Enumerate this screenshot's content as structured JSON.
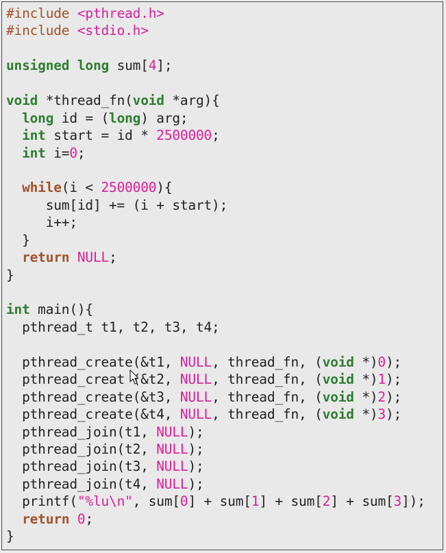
{
  "editor": {
    "lines": [
      [
        {
          "t": "pp",
          "v": "#include "
        },
        {
          "t": "hdr",
          "v": "<pthread.h>"
        }
      ],
      [
        {
          "t": "pp",
          "v": "#include "
        },
        {
          "t": "hdr",
          "v": "<stdio.h>"
        }
      ],
      [],
      [
        {
          "t": "kw",
          "v": "unsigned long"
        },
        {
          "t": "plain",
          "v": " sum["
        },
        {
          "t": "num",
          "v": "4"
        },
        {
          "t": "plain",
          "v": "];"
        }
      ],
      [],
      [
        {
          "t": "kw",
          "v": "void"
        },
        {
          "t": "plain",
          "v": " *thread_fn("
        },
        {
          "t": "kw",
          "v": "void"
        },
        {
          "t": "plain",
          "v": " *arg){"
        }
      ],
      [
        {
          "t": "plain",
          "v": "  "
        },
        {
          "t": "kw",
          "v": "long"
        },
        {
          "t": "plain",
          "v": " id = ("
        },
        {
          "t": "kw",
          "v": "long"
        },
        {
          "t": "plain",
          "v": ") arg;"
        }
      ],
      [
        {
          "t": "plain",
          "v": "  "
        },
        {
          "t": "kw",
          "v": "int"
        },
        {
          "t": "plain",
          "v": " start = id * "
        },
        {
          "t": "num",
          "v": "2500000"
        },
        {
          "t": "plain",
          "v": ";"
        }
      ],
      [
        {
          "t": "plain",
          "v": "  "
        },
        {
          "t": "kw",
          "v": "int"
        },
        {
          "t": "plain",
          "v": " i="
        },
        {
          "t": "num",
          "v": "0"
        },
        {
          "t": "plain",
          "v": ";"
        }
      ],
      [],
      [
        {
          "t": "plain",
          "v": "  "
        },
        {
          "t": "ctl",
          "v": "while"
        },
        {
          "t": "plain",
          "v": "(i < "
        },
        {
          "t": "num",
          "v": "2500000"
        },
        {
          "t": "plain",
          "v": "){"
        }
      ],
      [
        {
          "t": "plain",
          "v": "     sum[id] += (i + start);"
        }
      ],
      [
        {
          "t": "plain",
          "v": "     i++;"
        }
      ],
      [
        {
          "t": "plain",
          "v": "  }"
        }
      ],
      [
        {
          "t": "plain",
          "v": "  "
        },
        {
          "t": "ctl",
          "v": "return"
        },
        {
          "t": "plain",
          "v": " "
        },
        {
          "t": "null",
          "v": "NULL"
        },
        {
          "t": "plain",
          "v": ";"
        }
      ],
      [
        {
          "t": "plain",
          "v": "}"
        }
      ],
      [],
      [
        {
          "t": "kw",
          "v": "int"
        },
        {
          "t": "plain",
          "v": " main(){"
        }
      ],
      [
        {
          "t": "plain",
          "v": "  pthread_t t1, t2, t3, t4;"
        }
      ],
      [],
      [
        {
          "t": "plain",
          "v": "  pthread_create(&t1, "
        },
        {
          "t": "null",
          "v": "NULL"
        },
        {
          "t": "plain",
          "v": ", thread_fn, ("
        },
        {
          "t": "kw",
          "v": "void"
        },
        {
          "t": "plain",
          "v": " *)"
        },
        {
          "t": "num",
          "v": "0"
        },
        {
          "t": "plain",
          "v": ");"
        }
      ],
      [
        {
          "t": "plain",
          "v": "  pthread_creat (&t2, "
        },
        {
          "t": "null",
          "v": "NULL"
        },
        {
          "t": "plain",
          "v": ", thread_fn, ("
        },
        {
          "t": "kw",
          "v": "void"
        },
        {
          "t": "plain",
          "v": " *)"
        },
        {
          "t": "num",
          "v": "1"
        },
        {
          "t": "plain",
          "v": ");"
        }
      ],
      [
        {
          "t": "plain",
          "v": "  pthread_create(&t3, "
        },
        {
          "t": "null",
          "v": "NULL"
        },
        {
          "t": "plain",
          "v": ", thread_fn, ("
        },
        {
          "t": "kw",
          "v": "void"
        },
        {
          "t": "plain",
          "v": " *)"
        },
        {
          "t": "num",
          "v": "2"
        },
        {
          "t": "plain",
          "v": ");"
        }
      ],
      [
        {
          "t": "plain",
          "v": "  pthread_create(&t4, "
        },
        {
          "t": "null",
          "v": "NULL"
        },
        {
          "t": "plain",
          "v": ", thread_fn, ("
        },
        {
          "t": "kw",
          "v": "void"
        },
        {
          "t": "plain",
          "v": " *)"
        },
        {
          "t": "num",
          "v": "3"
        },
        {
          "t": "plain",
          "v": ");"
        }
      ],
      [
        {
          "t": "plain",
          "v": "  pthread_join(t1, "
        },
        {
          "t": "null",
          "v": "NULL"
        },
        {
          "t": "plain",
          "v": ");"
        }
      ],
      [
        {
          "t": "plain",
          "v": "  pthread_join(t2, "
        },
        {
          "t": "null",
          "v": "NULL"
        },
        {
          "t": "plain",
          "v": ");"
        }
      ],
      [
        {
          "t": "plain",
          "v": "  pthread_join(t3, "
        },
        {
          "t": "null",
          "v": "NULL"
        },
        {
          "t": "plain",
          "v": ");"
        }
      ],
      [
        {
          "t": "plain",
          "v": "  pthread_join(t4, "
        },
        {
          "t": "null",
          "v": "NULL"
        },
        {
          "t": "plain",
          "v": ");"
        }
      ],
      [
        {
          "t": "plain",
          "v": "  printf("
        },
        {
          "t": "str",
          "v": "\"%lu\\n\""
        },
        {
          "t": "plain",
          "v": ", sum["
        },
        {
          "t": "num",
          "v": "0"
        },
        {
          "t": "plain",
          "v": "] + sum["
        },
        {
          "t": "num",
          "v": "1"
        },
        {
          "t": "plain",
          "v": "] + sum["
        },
        {
          "t": "num",
          "v": "2"
        },
        {
          "t": "plain",
          "v": "] + sum["
        },
        {
          "t": "num",
          "v": "3"
        },
        {
          "t": "plain",
          "v": "]);"
        }
      ],
      [
        {
          "t": "plain",
          "v": "  "
        },
        {
          "t": "ctl",
          "v": "return"
        },
        {
          "t": "plain",
          "v": " "
        },
        {
          "t": "num",
          "v": "0"
        },
        {
          "t": "plain",
          "v": ";"
        }
      ],
      [
        {
          "t": "plain",
          "v": "}"
        }
      ]
    ]
  },
  "colors": {
    "background": "#e9e9e9",
    "keyword": "#2e7d32",
    "control": "#a0522d",
    "literal": "#d5209a",
    "text": "#222222"
  },
  "icons": {
    "cursor": "mouse-pointer-icon"
  }
}
